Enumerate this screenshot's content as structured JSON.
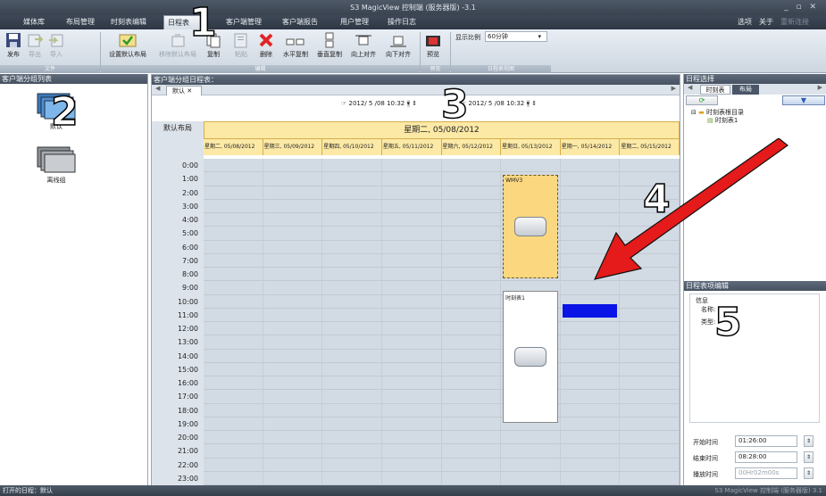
{
  "window": {
    "title": "S3 MagicView 控制端 (服务器版) -3.1",
    "controls": "_ ▫ ✕"
  },
  "menu": {
    "items": [
      "媒体库",
      "布局管理",
      "时刻表编辑",
      "日程表",
      "客户端管理",
      "客户端报告",
      "用户管理",
      "操作日志"
    ],
    "right": [
      "选项",
      "关于",
      "重新连接"
    ]
  },
  "ribbon": {
    "buttons": [
      "发布",
      "导出",
      "导入",
      "设置默认布局",
      "移除默认布局",
      "复制",
      "粘贴",
      "删除",
      "水平复制",
      "垂直复制",
      "向上对齐",
      "向下对齐",
      "预览"
    ],
    "scale_label": "显示比例",
    "scale_value": "60分钟",
    "groups": [
      "文件",
      "编辑",
      "预览",
      "日程表视图"
    ]
  },
  "left": {
    "header": "客户端分组列表",
    "groups": [
      "默认",
      "离线组"
    ]
  },
  "center": {
    "header": "客户端分组日程表：",
    "tab": "默认",
    "tab_close": "✕",
    "date_from": "2012/ 5 /08 10:32",
    "date_to": "2012/ 5 /08 10:32",
    "row_label": "默认布局",
    "main_date": "星期二, 05/08/2012",
    "days": [
      "星期二, 05/08/2012",
      "星期三, 05/09/2012",
      "星期四, 05/10/2012",
      "星期五, 05/11/2012",
      "星期六, 05/12/2012",
      "星期日, 05/13/2012",
      "星期一, 05/14/2012",
      "星期二, 05/15/2012"
    ],
    "hours": [
      "0:00",
      "1:00",
      "2:00",
      "3:00",
      "4:00",
      "5:00",
      "6:00",
      "7:00",
      "8:00",
      "9:00",
      "10:00",
      "11:00",
      "12:00",
      "13:00",
      "14:00",
      "15:00",
      "16:00",
      "17:00",
      "18:00",
      "19:00",
      "20:00",
      "21:00",
      "22:00",
      "23:00"
    ],
    "events": [
      {
        "label": "WMV3",
        "day_index": 5,
        "start_hour": 1.2,
        "end_hour": 8.8,
        "color": "#fbd87f"
      },
      {
        "label": "时刻表1",
        "day_index": 5,
        "start_hour": 9.7,
        "end_hour": 19.4,
        "color": "#ffffff"
      },
      {
        "label": "",
        "day_index": 6,
        "start_hour": 10.7,
        "end_hour": 11.7,
        "color": "#0a14e6"
      }
    ]
  },
  "right": {
    "selector_header": "日程选择",
    "tabs": [
      "时刻表",
      "布局"
    ],
    "tree_root": "时刻表根目录",
    "tree_child": "时刻表1",
    "editor_header": "日程表项编辑",
    "info_label": "信息",
    "name_label": "名称:",
    "type_label": "类型:",
    "start_label": "开始时间",
    "start_value": "01:26:00",
    "end_label": "结束时间",
    "end_value": "08:28:00",
    "duration_label": "播放时间",
    "duration_value": "00Hr02m00s"
  },
  "status": {
    "left": "打开的日程：默认",
    "right": "S3 MagicView 控制端 (服务器版) 3.1"
  },
  "annotations": [
    "1",
    "2",
    "3",
    "4",
    "5"
  ]
}
